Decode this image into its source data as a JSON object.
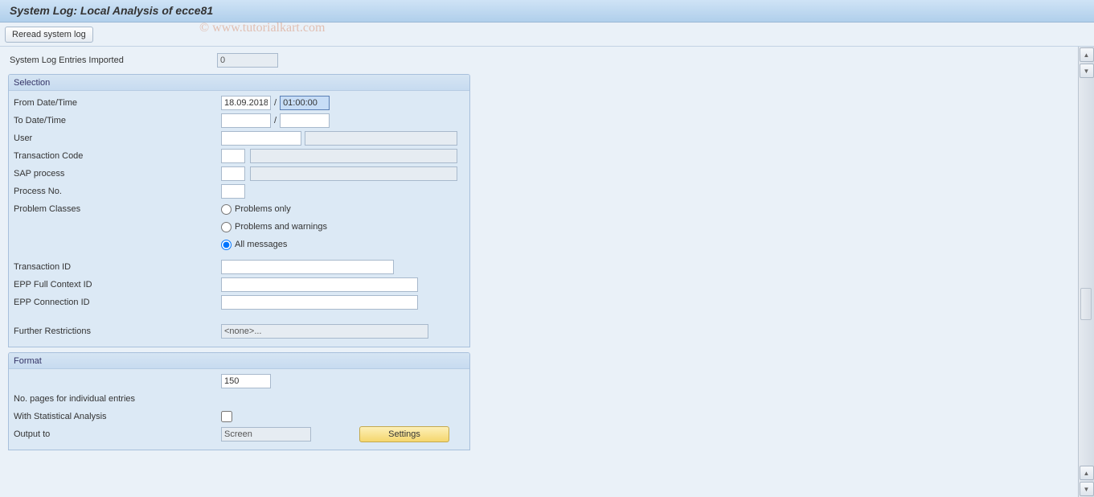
{
  "title": "System Log: Local Analysis of ecce81",
  "toolbar": {
    "reread": "Reread system log"
  },
  "entries": {
    "imported_label": "System Log Entries Imported",
    "imported_value": "0"
  },
  "selection": {
    "header": "Selection",
    "from_label": "From Date/Time",
    "from_date": "18.09.2018",
    "from_time": "01:00:00",
    "to_label": "To Date/Time",
    "to_date": "",
    "to_time": "",
    "user_label": "User",
    "user_value": "",
    "tcode_label": "Transaction Code",
    "tcode_value": "",
    "tcode_desc": "",
    "sap_proc_label": "SAP process",
    "sap_proc_value": "",
    "sap_proc_desc": "",
    "proc_no_label": "Process No.",
    "proc_no_value": "",
    "problem_classes_label": "Problem Classes",
    "pc_opt1": "Problems only",
    "pc_opt2": "Problems and warnings",
    "pc_opt3": "All messages",
    "tid_label": "Transaction ID",
    "tid_value": "",
    "epp_full_label": "EPP Full Context ID",
    "epp_full_value": "",
    "epp_conn_label": "EPP Connection ID",
    "epp_conn_value": "",
    "further_label": "Further Restrictions",
    "further_value": "<none>..."
  },
  "format": {
    "header": "Format",
    "pages_value": "150",
    "pages_label": "No. pages for individual entries",
    "stat_label": "With Statistical Analysis",
    "output_label": "Output to",
    "output_value": "Screen",
    "settings_btn": "Settings"
  },
  "watermark": "© www.tutorialkart.com"
}
